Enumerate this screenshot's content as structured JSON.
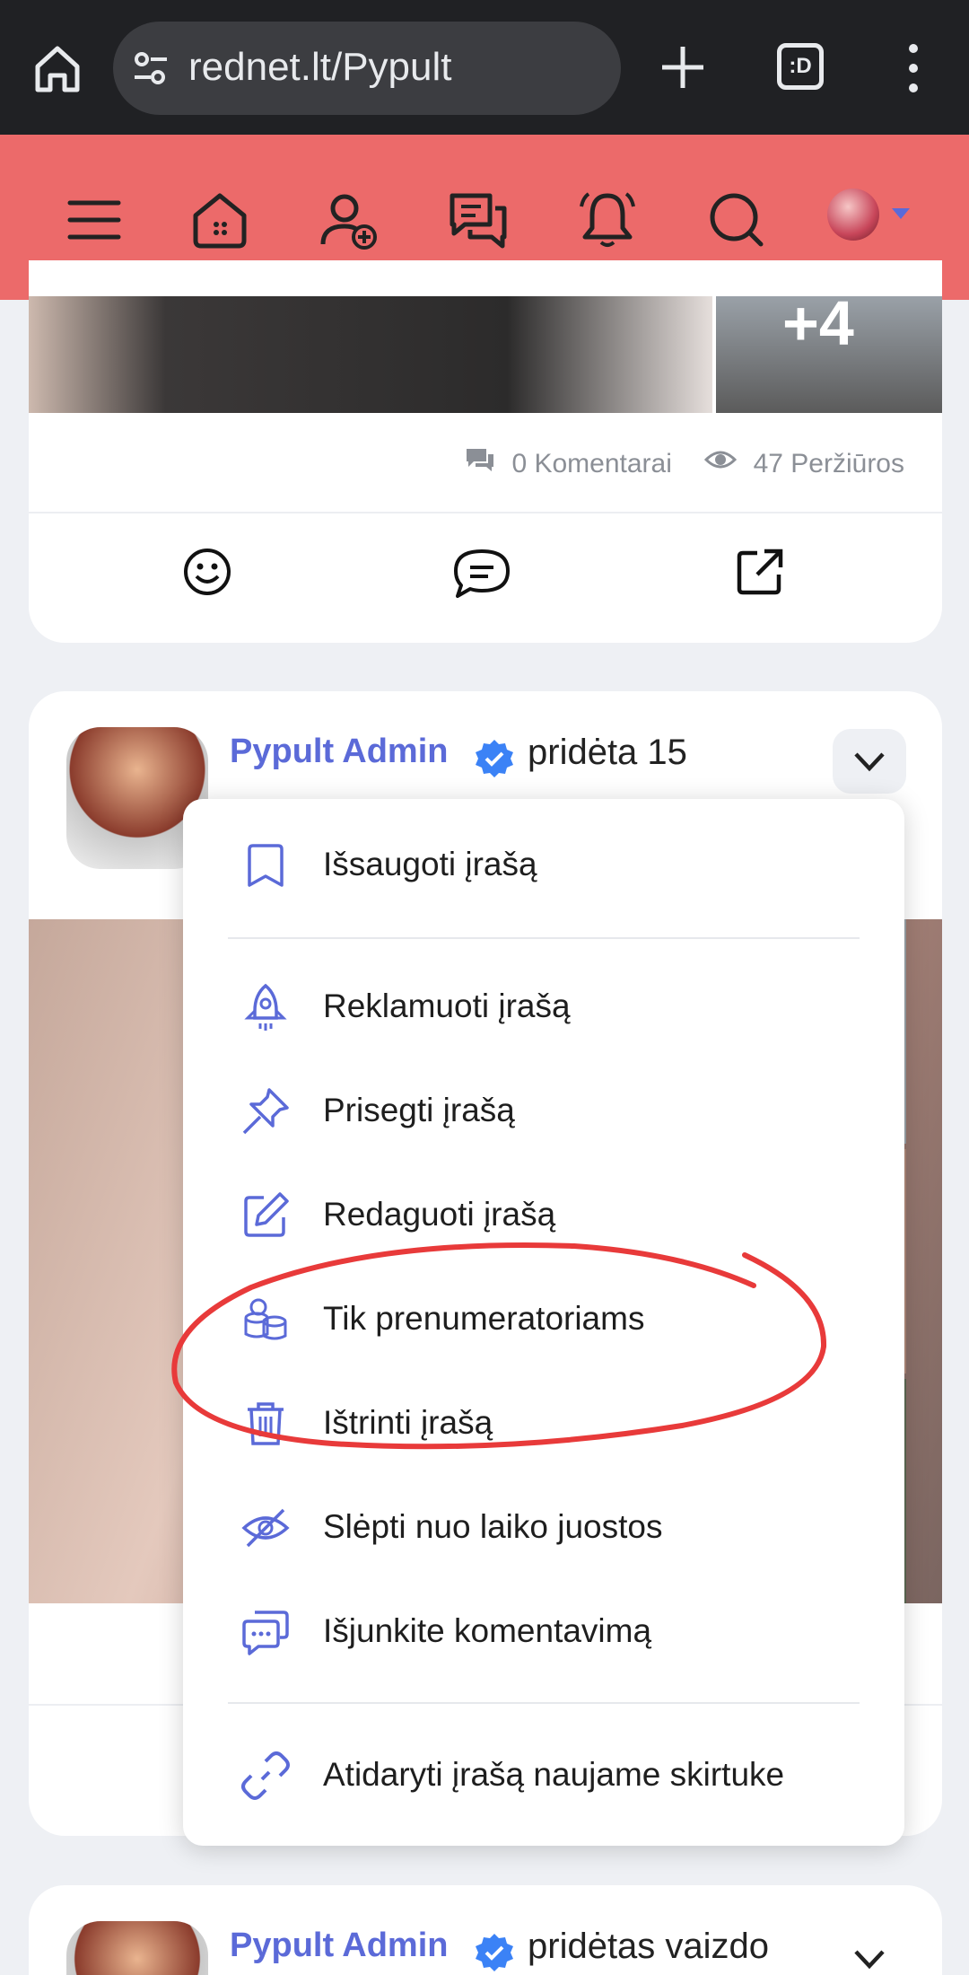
{
  "browser": {
    "url": "rednet.lt/Pypult",
    "tabs_label": ":D"
  },
  "card1": {
    "more_photos": "+4",
    "comments": "0 Komentarai",
    "views": "47 Peržiūros"
  },
  "post": {
    "author": "Pypult Admin",
    "action": "pridėta 15"
  },
  "menu": {
    "items": [
      {
        "label": "Išsaugoti įrašą",
        "icon": "bookmark-icon"
      },
      {
        "label": "Reklamuoti įrašą",
        "icon": "rocket-icon"
      },
      {
        "label": "Prisegti įrašą",
        "icon": "pin-icon"
      },
      {
        "label": "Redaguoti įrašą",
        "icon": "edit-icon"
      },
      {
        "label": "Tik prenumeratoriams",
        "icon": "coins-icon"
      },
      {
        "label": "Ištrinti įrašą",
        "icon": "trash-icon"
      },
      {
        "label": "Slėpti nuo laiko juostos",
        "icon": "eye-off-icon"
      },
      {
        "label": "Išjunkite komentavimą",
        "icon": "chat-bubbles-icon"
      },
      {
        "label": "Atidaryti įrašą naujame skirtuke",
        "icon": "link-icon"
      }
    ]
  },
  "post2": {
    "author": "Pypult Admin",
    "action": "pridėtas vaizdo"
  },
  "colors": {
    "header": "#ec6a6a",
    "accent": "#5b6ad8",
    "annotation": "#e83a3a"
  }
}
